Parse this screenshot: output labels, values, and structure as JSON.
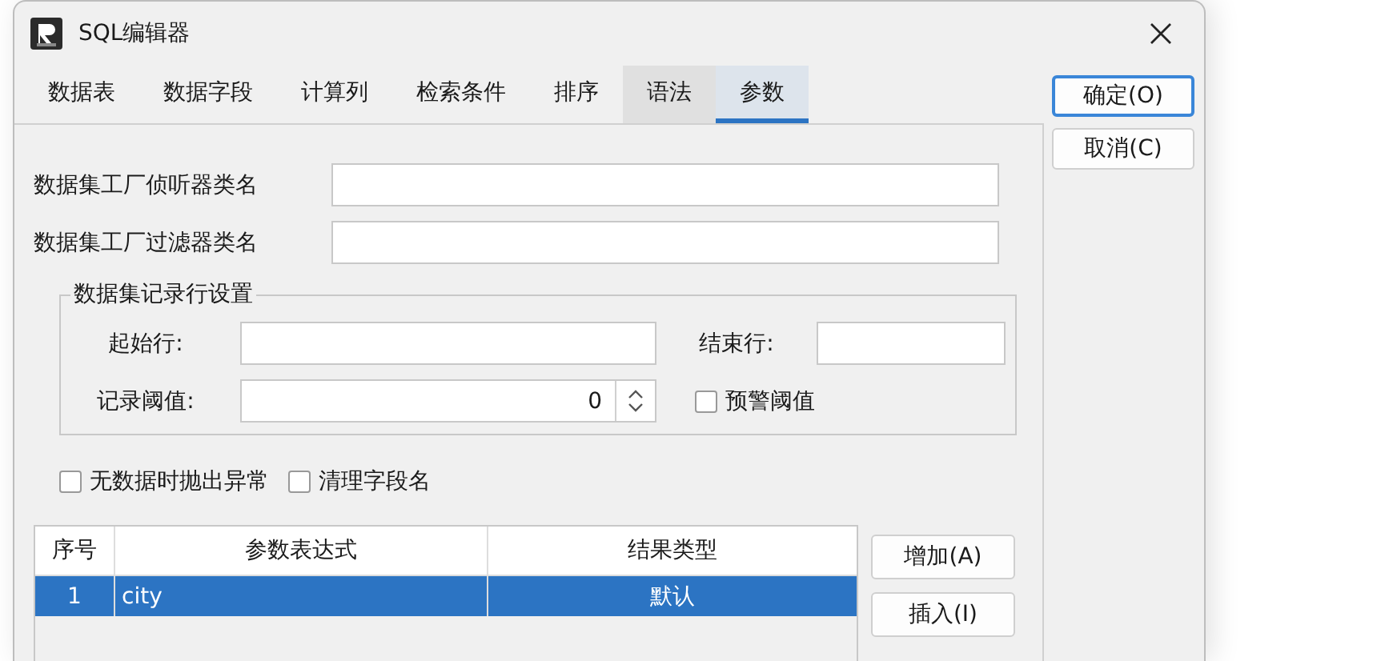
{
  "window": {
    "title": "SQL编辑器"
  },
  "tabs": [
    {
      "label": "数据表",
      "selected": false,
      "hovered": false
    },
    {
      "label": "数据字段",
      "selected": false,
      "hovered": false
    },
    {
      "label": "计算列",
      "selected": false,
      "hovered": false
    },
    {
      "label": "检索条件",
      "selected": false,
      "hovered": false
    },
    {
      "label": "排序",
      "selected": false,
      "hovered": false
    },
    {
      "label": "语法",
      "selected": false,
      "hovered": true
    },
    {
      "label": "参数",
      "selected": true,
      "hovered": false
    }
  ],
  "dialog_buttons": [
    {
      "label": "确定(O)",
      "default": true
    },
    {
      "label": "取消(C)",
      "default": false
    }
  ],
  "class_fields": [
    {
      "label": "数据集工厂侦听器类名"
    },
    {
      "label": "数据集工厂过滤器类名"
    }
  ],
  "row_settings": {
    "title": "数据集记录行设置",
    "start_label": "起始行:",
    "end_label": "结束行:",
    "threshold_label": "记录阈值:",
    "threshold_value": "0",
    "warn": {
      "label": "预警阈值",
      "checked": false
    }
  },
  "options": [
    {
      "label": "无数据时抛出异常",
      "checked": false
    },
    {
      "label": "清理字段名",
      "checked": false
    }
  ],
  "table": {
    "columns": [
      "序号",
      "参数表达式",
      "结果类型"
    ],
    "rows": [
      {
        "cells": [
          "1",
          "city",
          "默认"
        ],
        "selected": true
      }
    ]
  },
  "table_buttons": [
    "增加(A)",
    "插入(I)"
  ]
}
